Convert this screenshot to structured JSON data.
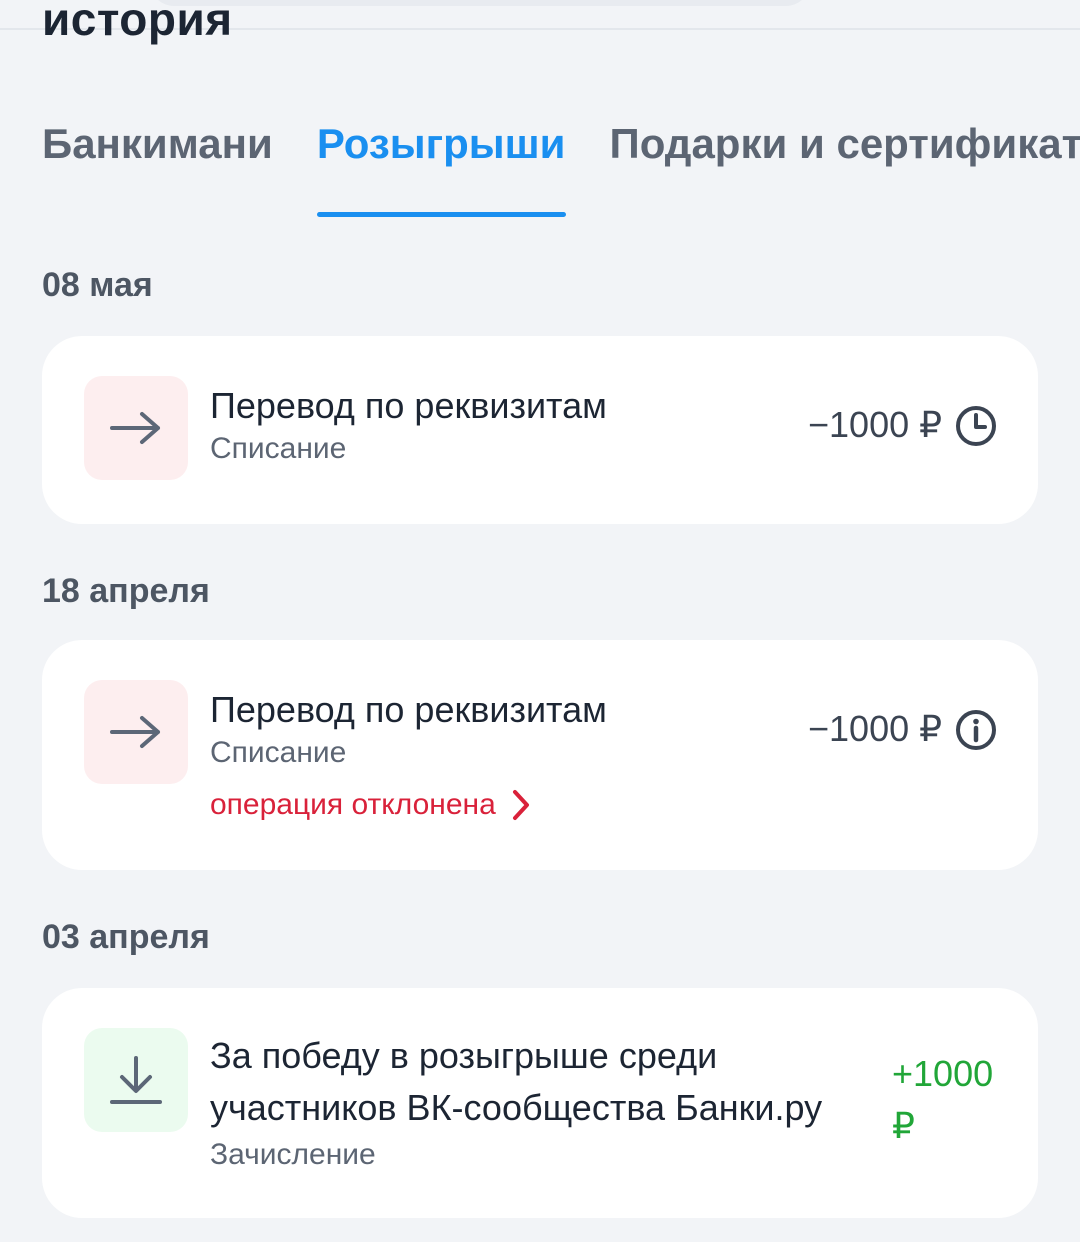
{
  "header": {
    "title": "история"
  },
  "tabs": [
    {
      "label": "Банкимани",
      "active": false
    },
    {
      "label": "Розыгрыши",
      "active": true
    },
    {
      "label": "Подарки и сертификаты",
      "active": false
    }
  ],
  "groups": [
    {
      "date": "08 мая",
      "operation": {
        "title": "Перевод по реквизитам",
        "subtitle": "Списание",
        "amount": "−1000 ₽",
        "status_icon": "clock-icon",
        "type_icon": "arrow-right-icon"
      }
    },
    {
      "date": "18 апреля",
      "operation": {
        "title": "Перевод по реквизитам",
        "subtitle": "Списание",
        "status_text": "операция отклонена",
        "amount": "−1000 ₽",
        "status_icon": "info-icon",
        "type_icon": "arrow-right-icon"
      }
    },
    {
      "date": "03 апреля",
      "operation": {
        "title_line1": "За победу в розыгрыше среди",
        "title_line2": "участников ВК-сообщества Банки.ру",
        "subtitle": "Зачисление",
        "amount_line1": "+1000",
        "amount_line2": "₽",
        "type_icon": "download-icon"
      }
    }
  ],
  "colors": {
    "accent": "#1a8ff0",
    "negative_status": "#d9213a",
    "positive_amount": "#21a638",
    "background": "#f2f4f7"
  }
}
